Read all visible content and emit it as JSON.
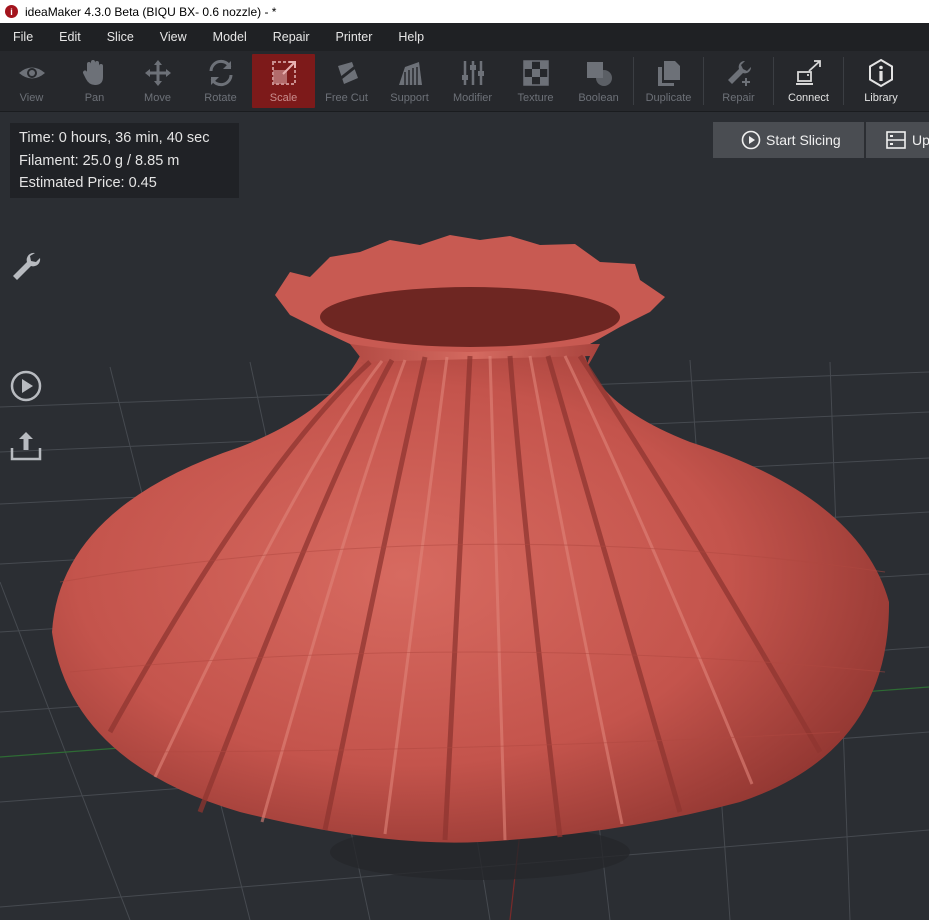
{
  "window": {
    "title": "ideaMaker 4.3.0 Beta (BIQU BX- 0.6 nozzle) - *",
    "app_icon_glyph": "i"
  },
  "menu": [
    "File",
    "Edit",
    "Slice",
    "View",
    "Model",
    "Repair",
    "Printer",
    "Help"
  ],
  "toolbar": {
    "tools": [
      {
        "label": "View",
        "icon": "eye-icon"
      },
      {
        "label": "Pan",
        "icon": "hand-icon"
      },
      {
        "label": "Move",
        "icon": "move-arrows-icon"
      },
      {
        "label": "Rotate",
        "icon": "rotate-icon"
      },
      {
        "label": "Scale",
        "icon": "scale-icon",
        "active": true
      },
      {
        "label": "Free Cut",
        "icon": "free-cut-icon"
      },
      {
        "label": "Support",
        "icon": "support-icon"
      },
      {
        "label": "Modifier",
        "icon": "modifier-sliders-icon"
      },
      {
        "label": "Texture",
        "icon": "texture-checker-icon"
      },
      {
        "label": "Boolean",
        "icon": "boolean-icon"
      },
      {
        "label": "Duplicate",
        "icon": "duplicate-icon"
      },
      {
        "label": "Repair",
        "icon": "wrench-plus-icon"
      },
      {
        "label": "Connect",
        "icon": "connect-icon"
      },
      {
        "label": "Library",
        "icon": "info-circle-icon"
      }
    ]
  },
  "stats": {
    "time": "Time: 0 hours, 36 min, 40 sec",
    "filament": "Filament: 25.0 g / 8.85 m",
    "price": "Estimated Price: 0.45"
  },
  "actions": {
    "start_slicing": "Start Slicing",
    "upload_partial": "Up"
  },
  "side_icons": [
    "wrench-icon",
    "play-circle-icon",
    "upload-icon"
  ],
  "colors": {
    "accent_active": "#7d1a1a",
    "model_color": "#c4544c",
    "viewport_bg": "#2b2e33"
  }
}
